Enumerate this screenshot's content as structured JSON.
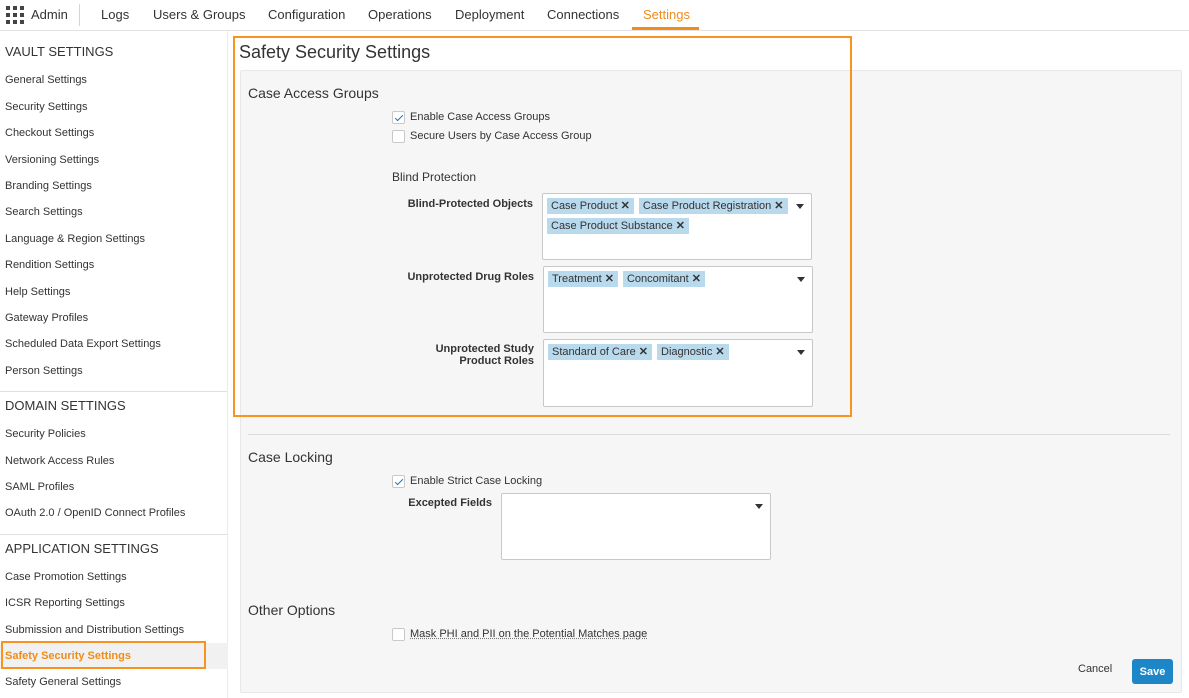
{
  "topnav": {
    "app_name": "Admin",
    "items": [
      "Logs",
      "Users & Groups",
      "Configuration",
      "Operations",
      "Deployment",
      "Connections",
      "Settings"
    ],
    "active": "Settings"
  },
  "sidebar": {
    "vault_settings": {
      "title": "VAULT SETTINGS",
      "items": [
        "General Settings",
        "Security Settings",
        "Checkout Settings",
        "Versioning Settings",
        "Branding Settings",
        "Search Settings",
        "Language & Region Settings",
        "Rendition Settings",
        "Help Settings",
        "Gateway Profiles",
        "Scheduled Data Export Settings",
        "Person Settings"
      ]
    },
    "domain_settings": {
      "title": "DOMAIN SETTINGS",
      "items": [
        "Security Policies",
        "Network Access Rules",
        "SAML Profiles",
        "OAuth 2.0 / OpenID Connect Profiles"
      ]
    },
    "application_settings": {
      "title": "APPLICATION SETTINGS",
      "items": [
        "Case Promotion Settings",
        "ICSR Reporting Settings",
        "Submission and Distribution Settings",
        "Safety Security Settings",
        "Safety General Settings"
      ],
      "active": "Safety Security Settings"
    }
  },
  "main": {
    "page_title": "Safety Security Settings",
    "case_access": {
      "title": "Case Access Groups",
      "enable_label": "Enable Case Access Groups",
      "enable_checked": true,
      "secure_label": "Secure Users by Case Access Group",
      "secure_checked": false,
      "blind_heading": "Blind Protection",
      "blind_objects_label": "Blind-Protected Objects",
      "blind_objects": [
        "Case Product",
        "Case Product Registration",
        "Case Product Substance"
      ],
      "drug_roles_label": "Unprotected Drug Roles",
      "drug_roles": [
        "Treatment",
        "Concomitant"
      ],
      "study_roles_label_1": "Unprotected Study",
      "study_roles_label_2": "Product Roles",
      "study_roles": [
        "Standard of Care",
        "Diagnostic"
      ]
    },
    "case_locking": {
      "title": "Case Locking",
      "strict_label": "Enable Strict Case Locking",
      "strict_checked": true,
      "excepted_label": "Excepted Fields"
    },
    "other": {
      "title": "Other Options",
      "mask_label": "Mask PHI and PII on the Potential Matches page",
      "mask_checked": false
    },
    "actions": {
      "cancel": "Cancel",
      "save": "Save"
    }
  },
  "colors": {
    "accent": "#f08c1a",
    "highlight": "#f7931e",
    "tag": "#b9d9ec",
    "primary_button": "#1c86c7"
  }
}
